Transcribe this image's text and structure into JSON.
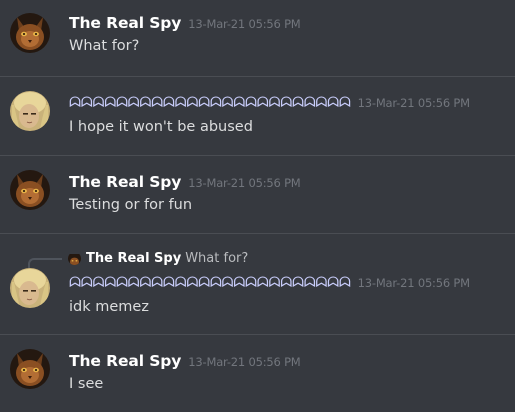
{
  "messages": [
    {
      "author": "The Real Spy",
      "timestamp": "13-Mar-21 05:56 PM",
      "content": "What for?"
    },
    {
      "author": "ᗣᗣᗣᗣᗣᗣᗣᗣᗣᗣᗣᗣᗣᗣᗣᗣᗣᗣᗣᗣᗣᗣᗣᗣ",
      "timestamp": "13-Mar-21 05:56 PM",
      "content": "I hope it won't be abused"
    },
    {
      "author": "The Real Spy",
      "timestamp": "13-Mar-21 05:56 PM",
      "content": "Testing or for fun"
    },
    {
      "reply": {
        "author": "The Real Spy",
        "text": "What for?"
      },
      "author": "ᗣᗣᗣᗣᗣᗣᗣᗣᗣᗣᗣᗣᗣᗣᗣᗣᗣᗣᗣᗣᗣᗣᗣᗣ",
      "timestamp": "13-Mar-21 05:56 PM",
      "content": "idk memez"
    },
    {
      "author": "The Real Spy",
      "timestamp": "13-Mar-21 05:56 PM",
      "content": "I see"
    }
  ],
  "colors": {
    "background": "#36393f",
    "divider": "#4a4d53",
    "author_default": "#ffffff",
    "author_accent": "#c9cdfb",
    "timestamp": "#72767d",
    "content": "#dcddde"
  },
  "icons": {
    "spy_avatar": "cat-avatar-icon",
    "other_avatar": "blonde-avatar-icon"
  }
}
